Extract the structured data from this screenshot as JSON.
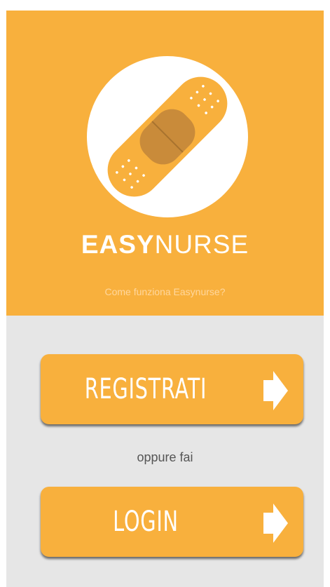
{
  "brand": {
    "bold": "EASY",
    "light": "NURSE"
  },
  "hero": {
    "link": "Come funziona Easynurse?"
  },
  "buttons": {
    "register": "REGISTRATI",
    "login": "LOGIN"
  },
  "separator": "oppure fai",
  "icons": {
    "logo": "bandage-icon",
    "arrow": "arrow-right-icon"
  },
  "colors": {
    "accent": "#f8b03d",
    "background": "#e6e6e6",
    "text": "#ffffff"
  }
}
